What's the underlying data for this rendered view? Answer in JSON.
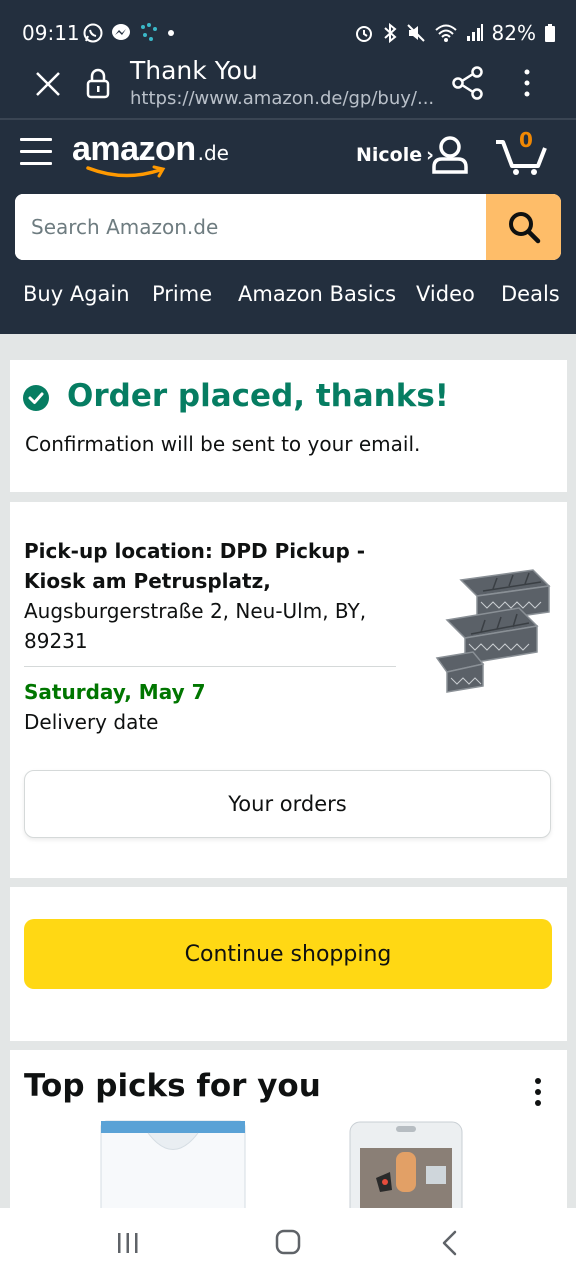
{
  "status_bar": {
    "time": "09:11",
    "battery": "82%"
  },
  "browser": {
    "tab_title": "Thank You",
    "url": "https://www.amazon.de/gp/buy/..."
  },
  "header": {
    "logo_word": "amazon",
    "logo_tld": ".de",
    "account_name": "Nicole",
    "account_chevron": "›",
    "cart_count": "0",
    "search_placeholder": "Search Amazon.de",
    "nav_links": [
      "Buy Again",
      "Prime",
      "Amazon Basics",
      "Video",
      "Deals"
    ]
  },
  "confirmation": {
    "headline": "Order placed, thanks!",
    "subtext": "Confirmation will be sent to your email."
  },
  "pickup": {
    "location_title": "Pick-up location: DPD Pickup - Kiosk am Petrusplatz,",
    "address": "Augsburgerstraße 2, Neu-Ulm, BY, 89231",
    "delivery_date": "Saturday, May 7",
    "delivery_label": "Delivery date",
    "orders_button": "Your orders"
  },
  "continue_button": "Continue shopping",
  "top_picks": {
    "title": "Top picks for you"
  },
  "colors": {
    "header_bg": "#232f3e",
    "success_green": "#067d62",
    "delivery_green": "#007600",
    "primary_button": "#ffd814",
    "search_button": "#febd69",
    "cart_count": "#f08804"
  }
}
